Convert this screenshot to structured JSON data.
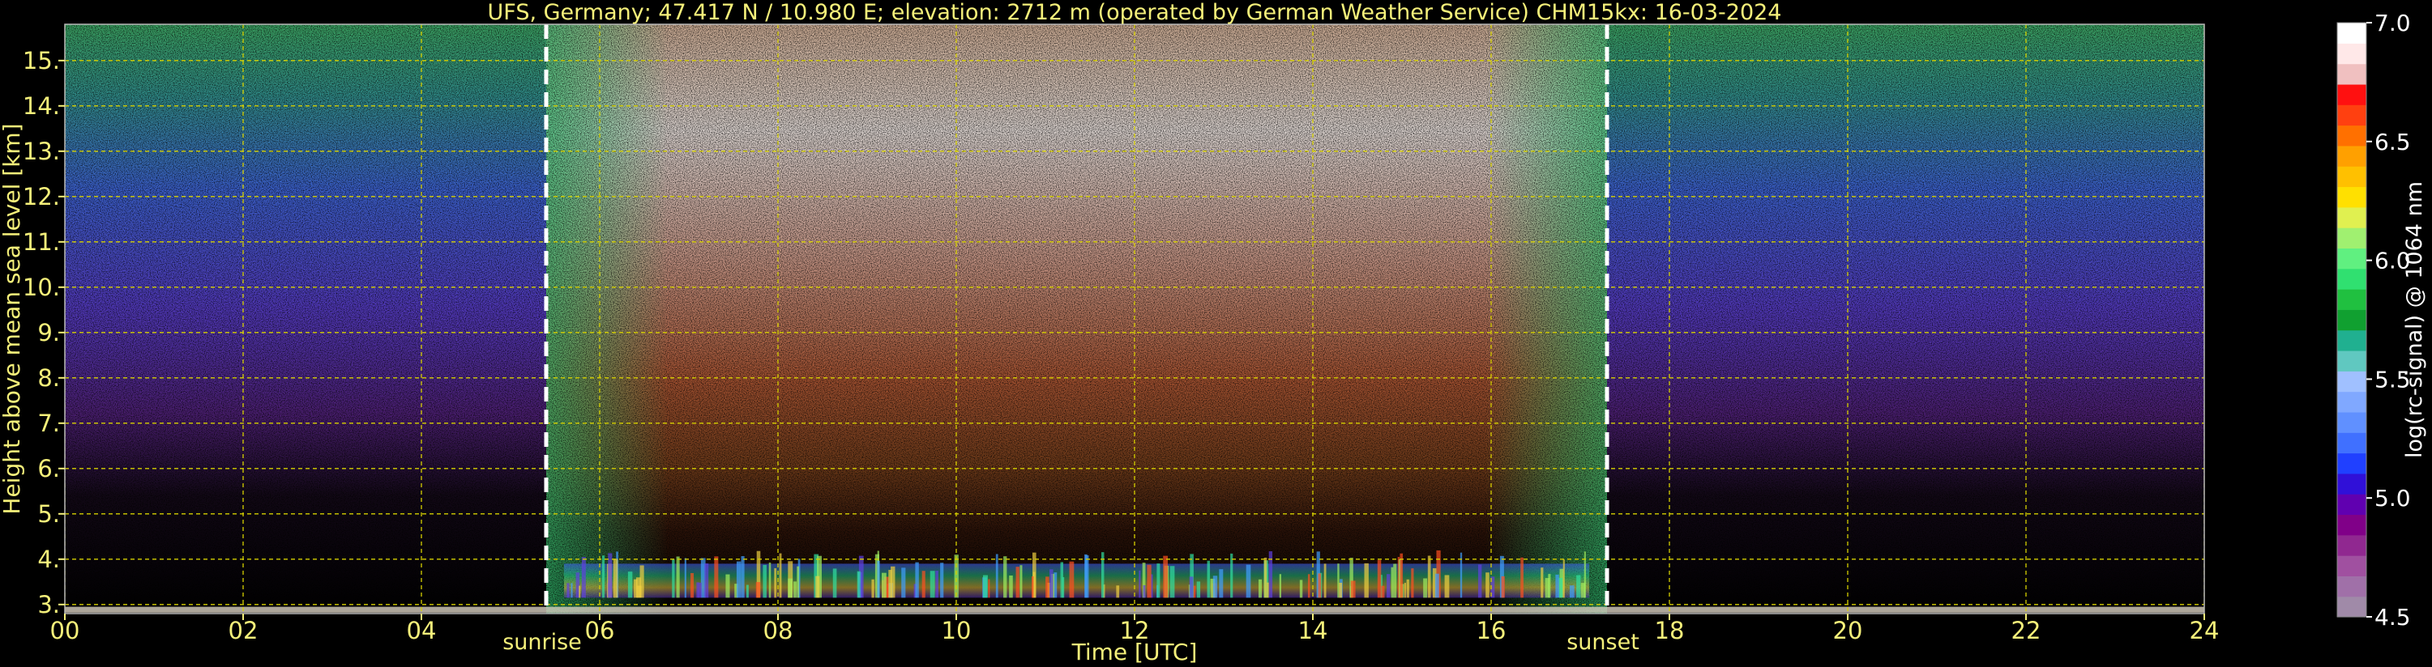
{
  "chart_data": {
    "type": "heatmap",
    "title": "UFS, Germany; 47.417 N / 10.980 E; elevation: 2712 m  (operated by German Weather Service)    CHM15kx: 16-03-2024",
    "xlabel": "Time [UTC]",
    "ylabel": "Height above mean sea level [km]",
    "xlim": [
      0,
      24
    ],
    "ylim": [
      2.8,
      15.8
    ],
    "x_ticks": [
      0,
      2,
      4,
      6,
      8,
      10,
      12,
      14,
      16,
      18,
      20,
      22,
      24
    ],
    "x_tick_labels": [
      "00",
      "02",
      "04",
      "06",
      "08",
      "10",
      "12",
      "14",
      "16",
      "18",
      "20",
      "22",
      "24"
    ],
    "y_ticks": [
      3,
      4,
      5,
      6,
      7,
      8,
      9,
      10,
      11,
      12,
      13,
      14,
      15
    ],
    "y_tick_labels": [
      "3.",
      "4.",
      "5.",
      "6.",
      "7.",
      "8.",
      "9.",
      "10.",
      "11.",
      "12.",
      "13.",
      "14.",
      "15."
    ],
    "grid": true,
    "markers": [
      {
        "label": "sunrise",
        "x": 5.4
      },
      {
        "label": "sunset",
        "x": 17.3
      }
    ],
    "colorbar": {
      "label": "log(rc-signal) @ 1064 nm",
      "range": [
        4.5,
        7.0
      ],
      "ticks": [
        4.5,
        5.0,
        5.5,
        6.0,
        6.5,
        7.0
      ],
      "tick_labels": [
        "4.5",
        "5.0",
        "5.5",
        "6.0",
        "6.5",
        "7.0"
      ],
      "colors": [
        "#a08aa8",
        "#a070a8",
        "#a050a0",
        "#902890",
        "#800088",
        "#6000b0",
        "#3010d8",
        "#2040ff",
        "#4070ff",
        "#6090ff",
        "#80a8ff",
        "#a0c0ff",
        "#60c8c0",
        "#20b090",
        "#10a030",
        "#20c040",
        "#30e070",
        "#60f080",
        "#a0f070",
        "#e0f050",
        "#ffe000",
        "#ffc000",
        "#ffa000",
        "#ff7000",
        "#ff4010",
        "#ff1010",
        "#f0c0c0",
        "#ffe8e8",
        "#ffffff"
      ]
    }
  }
}
